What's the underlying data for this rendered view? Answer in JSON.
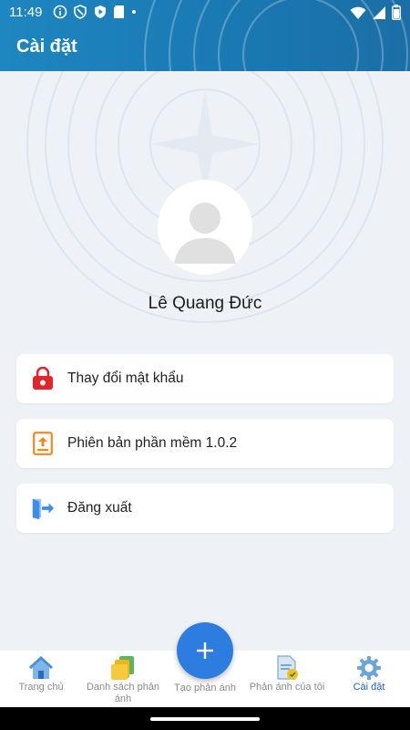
{
  "status_bar": {
    "time": "11:49"
  },
  "header": {
    "title": "Cài đặt"
  },
  "profile": {
    "name": "Lê Quang Đức"
  },
  "menu": [
    {
      "label": "Thay đổi mật khẩu",
      "icon": "lock-icon",
      "color": "#e0262b"
    },
    {
      "label": "Phiên bản phần mềm 1.0.2",
      "icon": "upload-file-icon",
      "color": "#f08a1c"
    },
    {
      "label": "Đăng xuất",
      "icon": "logout-icon",
      "color": "#3d8ee6"
    }
  ],
  "bottom_nav": {
    "home": "Trang chủ",
    "list": "Danh sách phản ánh",
    "create": "Tạo phản ánh",
    "mine": "Phản ánh của tôi",
    "settings": "Cài đặt"
  },
  "colors": {
    "accent": "#1e86c0",
    "active_tab": "#1e5fbf",
    "fab": "#2d7de0"
  }
}
